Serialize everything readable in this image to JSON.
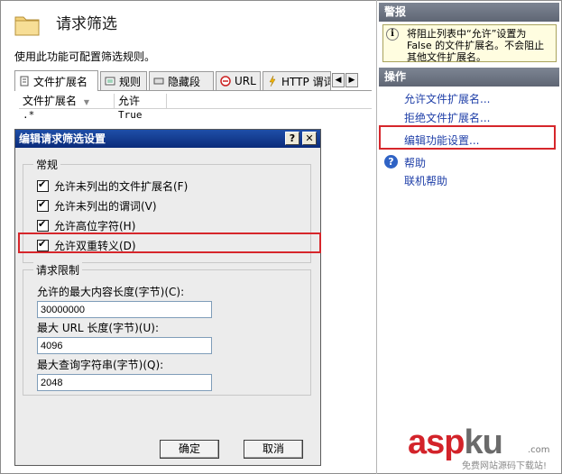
{
  "main": {
    "title": "请求筛选",
    "description": "使用此功能可配置筛选规则。",
    "tabs": [
      {
        "label": "文件扩展名",
        "icon": "page-icon"
      },
      {
        "label": "规则",
        "icon": "rules-icon"
      },
      {
        "label": "隐藏段",
        "icon": "hidden-segment-icon"
      },
      {
        "label": "URL",
        "icon": "url-block-icon"
      },
      {
        "label": "HTTP 谓词",
        "icon": "http-verb-icon"
      }
    ],
    "columns": [
      "文件扩展名",
      "允许"
    ],
    "rows": [
      {
        "ext": ".*",
        "allowed": "True"
      }
    ]
  },
  "dialog": {
    "title": "编辑请求筛选设置",
    "help_btn": "?",
    "close_btn": "✕",
    "general_label": "常规",
    "options": [
      {
        "label": "允许未列出的文件扩展名(F)",
        "checked": true
      },
      {
        "label": "允许未列出的谓词(V)",
        "checked": true
      },
      {
        "label": "允许高位字符(H)",
        "checked": true
      },
      {
        "label": "允许双重转义(D)",
        "checked": true
      }
    ],
    "limits_label": "请求限制",
    "fields": [
      {
        "label": "允许的最大内容长度(字节)(C):",
        "value": "30000000"
      },
      {
        "label": "最大 URL 长度(字节)(U):",
        "value": "4096"
      },
      {
        "label": "最大查询字符串(字节)(Q):",
        "value": "2048"
      }
    ],
    "ok": "确定",
    "cancel": "取消"
  },
  "side": {
    "alert_header": "警报",
    "alert_text": "将阻止列表中“允许”设置为 False 的文件扩展名。不会阻止其他文件扩展名。",
    "actions_header": "操作",
    "actions": [
      "允许文件扩展名...",
      "拒绝文件扩展名...",
      "编辑功能设置..."
    ],
    "help": "帮助",
    "online_help": "联机帮助"
  },
  "watermark": {
    "brand_a": "asp",
    "brand_b": "ku",
    "suffix": ".com",
    "sub": "免费网站源码下载站!"
  },
  "colors": {
    "highlight": "#d6262b",
    "title_bar": "#0a2b7a",
    "link": "#1f3fa8"
  }
}
